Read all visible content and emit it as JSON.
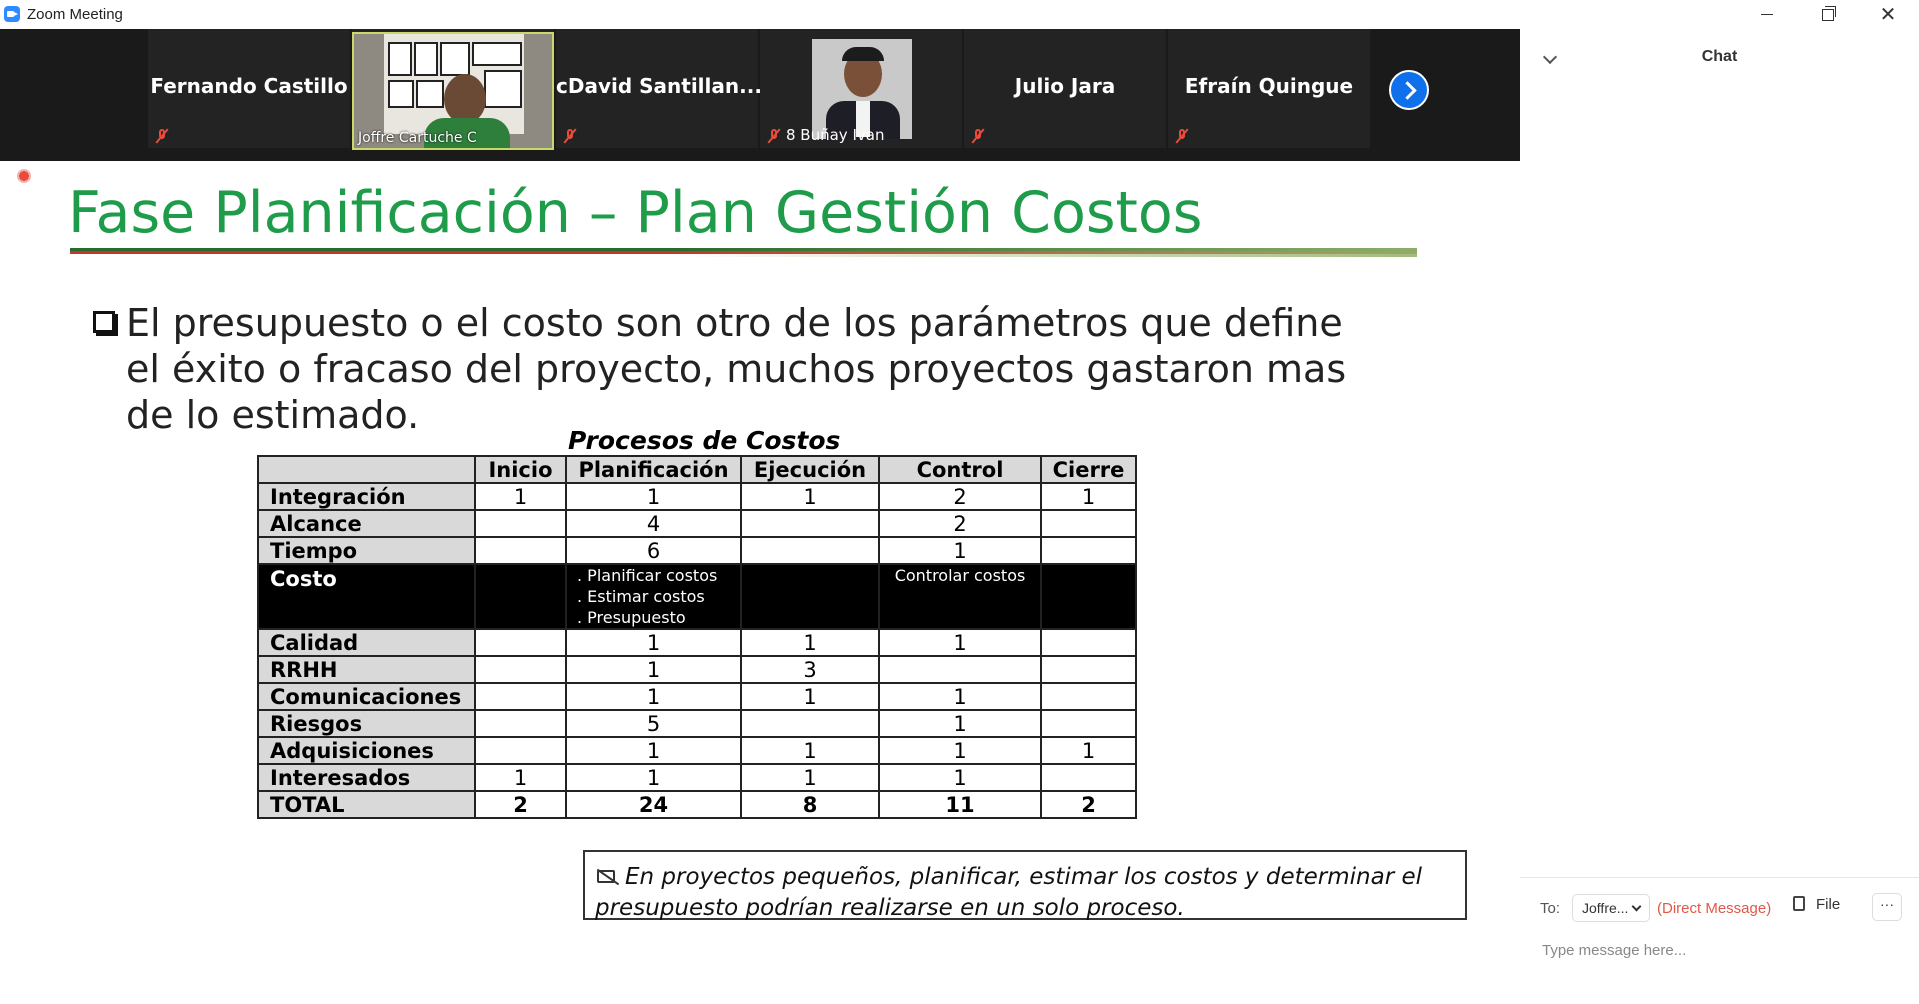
{
  "window": {
    "title": "Zoom Meeting"
  },
  "participants": [
    {
      "name": "Fernando Castillo",
      "muted": true
    },
    {
      "name": "Joffre Cartuche C",
      "muted": false,
      "video": true
    },
    {
      "name": "cDavid  Santillan...",
      "muted": true
    },
    {
      "name": "8 Buñay Ivan",
      "muted": true,
      "video": true
    },
    {
      "name": "Julio Jara",
      "muted": true
    },
    {
      "name": "Efraín Quingue",
      "muted": true
    }
  ],
  "slide": {
    "title": "Fase Planificación – Plan Gestión Costos",
    "bullet": "El presupuesto o el costo son otro de los parámetros que define el éxito o fracaso del proyecto, muchos proyectos gastaron mas de lo estimado.",
    "table": {
      "title": "Procesos de Costos",
      "headers": [
        "Inicio",
        "Planificación",
        "Ejecución",
        "Control",
        "Cierre"
      ],
      "rows": [
        {
          "label": "Integración",
          "cells": [
            "1",
            "1",
            "1",
            "2",
            "1"
          ]
        },
        {
          "label": "Alcance",
          "cells": [
            "",
            "4",
            "",
            "2",
            ""
          ]
        },
        {
          "label": "Tiempo",
          "cells": [
            "",
            "6",
            "",
            "1",
            ""
          ]
        }
      ],
      "costo": {
        "label": "Costo",
        "planificacion": ". Planificar costos",
        "planificacion2": ". Estimar costos",
        "planificacion3": ". Presupuesto",
        "control": "Controlar costos"
      },
      "rows2": [
        {
          "label": "Calidad",
          "cells": [
            "",
            "1",
            "1",
            "1",
            ""
          ]
        },
        {
          "label": "RRHH",
          "cells": [
            "",
            "1",
            "3",
            "",
            ""
          ]
        },
        {
          "label": "Comunicaciones",
          "cells": [
            "",
            "1",
            "1",
            "1",
            ""
          ]
        },
        {
          "label": "Riesgos",
          "cells": [
            "",
            "5",
            "",
            "1",
            ""
          ]
        },
        {
          "label": "Adquisiciones",
          "cells": [
            "",
            "1",
            "1",
            "1",
            "1"
          ]
        },
        {
          "label": "Interesados",
          "cells": [
            "1",
            "1",
            "1",
            "1",
            ""
          ]
        }
      ],
      "total": {
        "label": "TOTAL",
        "cells": [
          "2",
          "24",
          "8",
          "11",
          "2"
        ]
      }
    },
    "note": "En proyectos pequeños, planificar, estimar los costos y determinar el presupuesto podrían realizarse en un solo proceso."
  },
  "chat": {
    "title": "Chat",
    "to_label": "To:",
    "recipient": "Joffre...",
    "dm_label": "(Direct Message)",
    "file_label": "File",
    "more_label": "···",
    "placeholder": "Type message here..."
  }
}
